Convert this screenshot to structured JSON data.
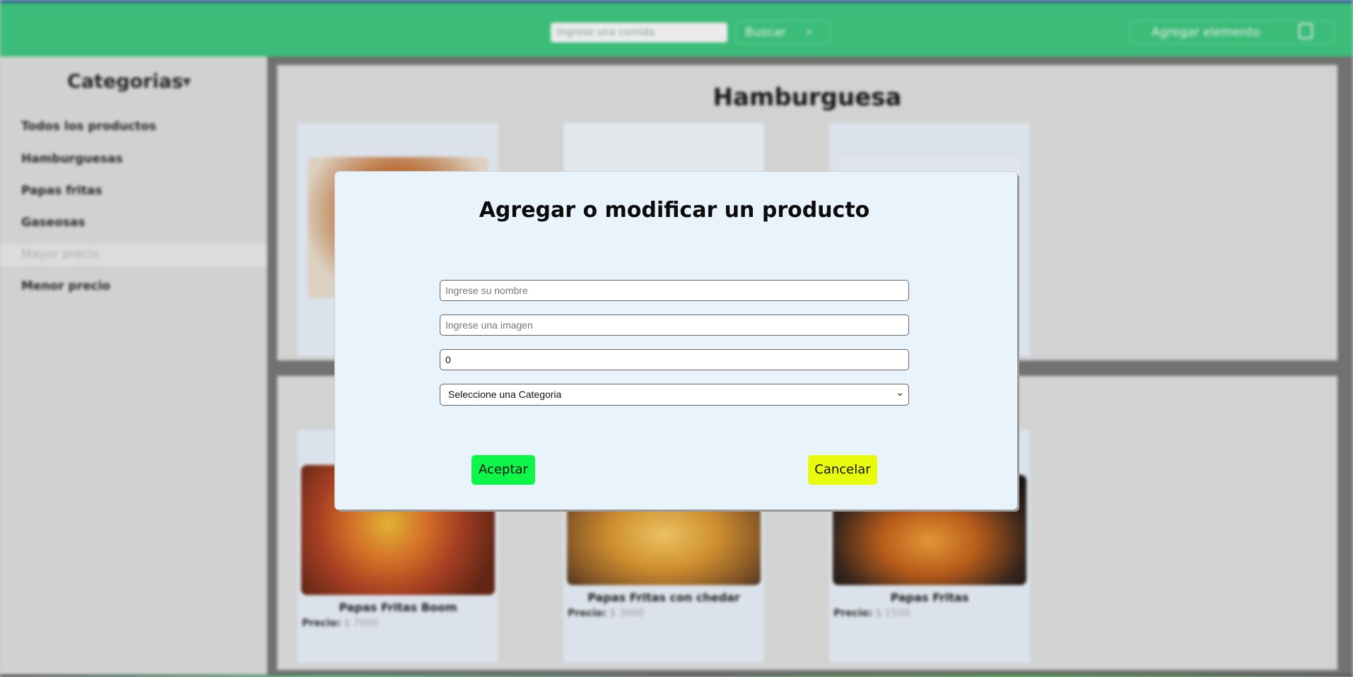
{
  "navbar": {
    "search_placeholder": "Ingrese una comida",
    "search_button": "Buscar",
    "search_icon": "search-icon",
    "add_button": "Agregar elemento",
    "add_icon": "document-icon",
    "color": "#41cd83"
  },
  "sidebar": {
    "title": "Categorias",
    "items": [
      {
        "label": "Todos los productos"
      },
      {
        "label": "Hamburguesas"
      },
      {
        "label": "Papas fritas"
      },
      {
        "label": "Gaseosas"
      },
      {
        "label": "Mayor precio"
      },
      {
        "label": "Menor precio"
      }
    ]
  },
  "main": {
    "section_title": "Hamburguesa",
    "cards": [
      {
        "name": "Papas Fritas Boom",
        "price_label": "Precio:",
        "price": "$ 7000"
      },
      {
        "name": "Papas Fritas con chedar",
        "price_label": "Precio:",
        "price": "$ 3000"
      },
      {
        "name": "Papas Fritas",
        "price_label": "Precio:",
        "price": "$ 1500"
      }
    ]
  },
  "modal": {
    "title": "Agregar o modificar un producto",
    "name_placeholder": "Ingrese su nombre",
    "image_placeholder": "Ingrese una imagen",
    "price_value": "0",
    "category_select": "Seleccione una Categoria",
    "accept_label": "Aceptar",
    "cancel_label": "Cancelar",
    "accept_color": "#0ef748",
    "cancel_color": "#e9fb0c"
  }
}
